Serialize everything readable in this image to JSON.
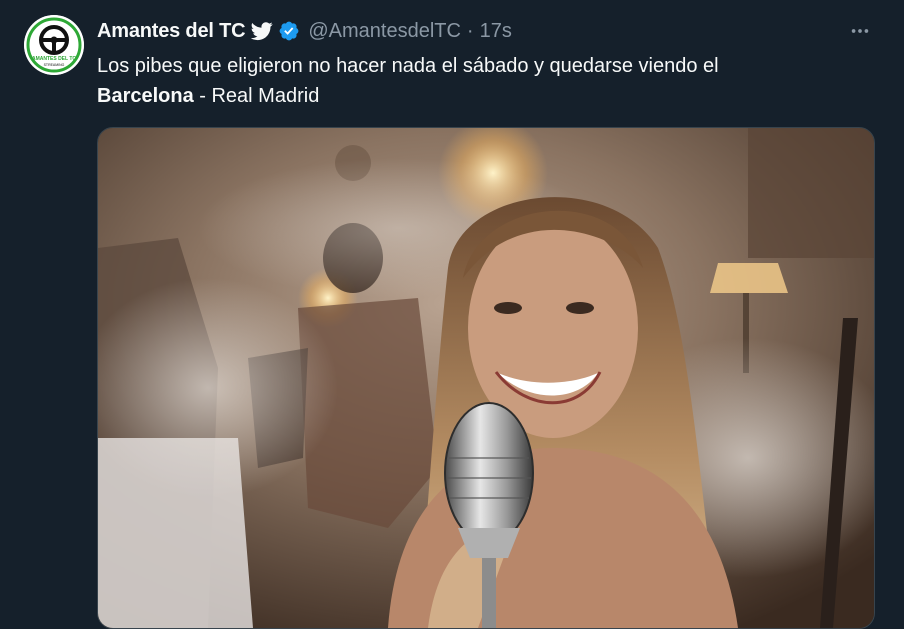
{
  "tweet": {
    "author": {
      "display_name": "Amantes del TC",
      "handle": "@AmantesdelTC",
      "avatar_logo_text": "AMANTES DEL TC",
      "avatar_logo_subtext": "STREAMING"
    },
    "separator": "·",
    "timestamp": "17s",
    "text": {
      "line1": "Los pibes que eligieron no hacer nada el sábado y quedarse viendo el",
      "bold": "Barcelona",
      "rest": " - Real Madrid"
    },
    "media": {
      "kind": "video-frame"
    }
  },
  "icons": {
    "bird": "twitter-bird-icon",
    "verified": "verified-badge-icon",
    "more": "more-options-icon"
  },
  "colors": {
    "background": "#15202b",
    "text_primary": "#f7f9f9",
    "text_secondary": "#8b98a5",
    "verified_blue": "#1d9bf0",
    "avatar_green": "#2ea836"
  }
}
